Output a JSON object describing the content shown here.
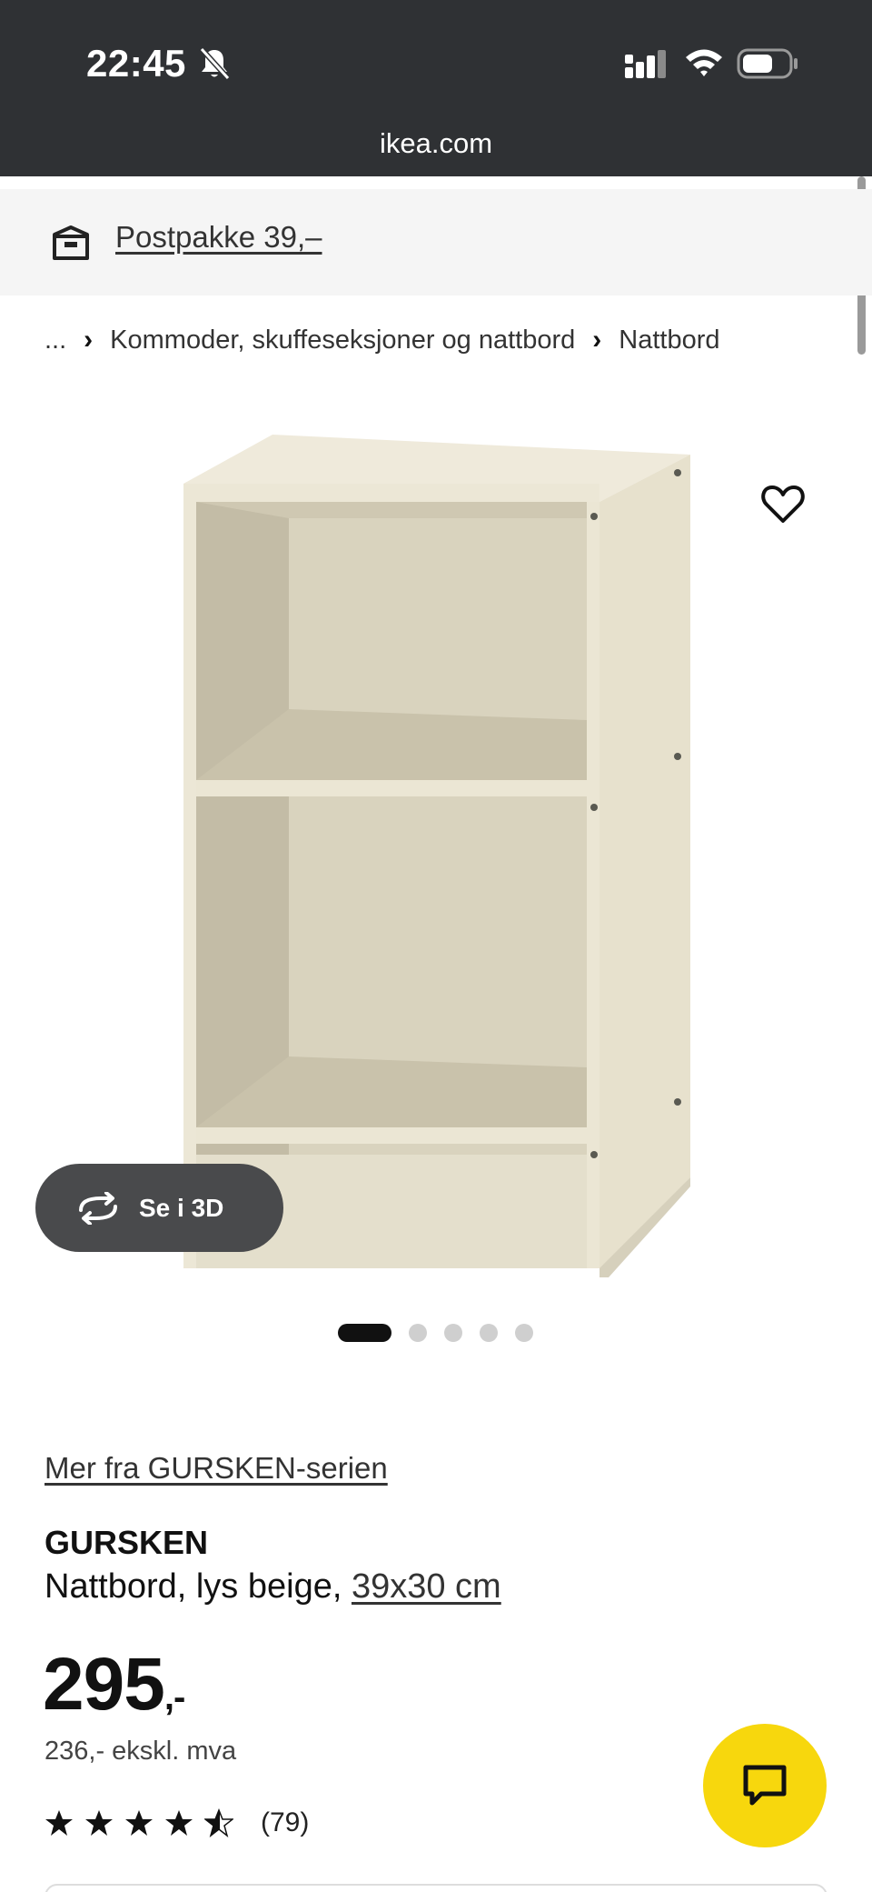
{
  "status_bar": {
    "time": "22:45",
    "icons": [
      "bell-slash-icon",
      "signal-icon",
      "wifi-icon",
      "battery-icon"
    ]
  },
  "browser": {
    "url": "ikea.com"
  },
  "delivery": {
    "icon": "delivery-box-icon",
    "label": "Postpakke 39,–"
  },
  "breadcrumb": {
    "items": [
      "...",
      "Kommoder, skuffeseksjoner og nattbord",
      "Nattbord"
    ],
    "separator": "›"
  },
  "gallery": {
    "image_alt": "GURSKEN nattbord, lys beige",
    "favorite_icon": "heart-outline-icon",
    "view_3d_label": "Se i 3D",
    "view_3d_icon": "rotate-icon",
    "dot_count": 5,
    "active_index": 0
  },
  "product": {
    "series_link": "Mer fra GURSKEN-serien",
    "name": "GURSKEN",
    "description": "Nattbord, lys beige, ",
    "size": "39x30 cm",
    "price": "295",
    "price_suffix": ",-",
    "price_ex_vat": "236,- ekskl. mva",
    "rating": 4.5,
    "rating_max": 5,
    "review_count": "(79)"
  },
  "chat": {
    "icon": "chat-bubble-icon"
  },
  "colors": {
    "header_bg": "#2f3134",
    "banner_bg": "#f5f5f5",
    "chat_button": "#f7d70d",
    "button_3d": "#494a4c",
    "shelf": "#e6e0cc"
  }
}
